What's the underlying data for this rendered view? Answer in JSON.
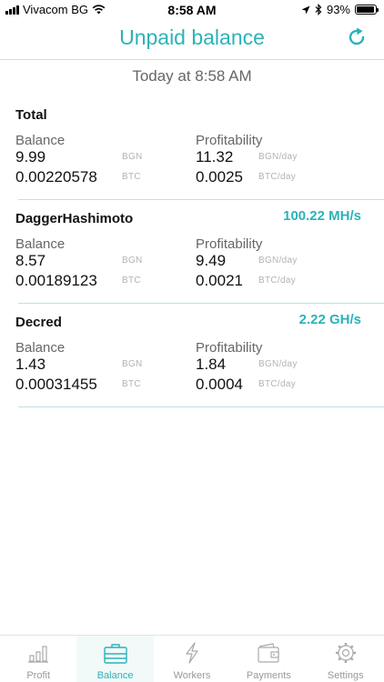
{
  "status_bar": {
    "carrier": "Vivacom BG",
    "time": "8:58 AM",
    "battery": "93%",
    "battery_level": 0.93,
    "icons": [
      "signal-icon",
      "wifi-icon",
      "location-icon",
      "bluetooth-icon",
      "battery-icon"
    ]
  },
  "header": {
    "title": "Unpaid balance",
    "refresh_icon": "refresh-icon"
  },
  "timestamp": "Today at 8:58 AM",
  "labels": {
    "balance": "Balance",
    "profitability": "Profitability",
    "bgn": "BGN",
    "btc": "BTC",
    "bgn_day": "BGN/day",
    "btc_day": "BTC/day"
  },
  "sections": [
    {
      "title": "Total",
      "rate": "",
      "balance_bgn": "9.99",
      "balance_btc": "0.00220578",
      "profit_bgn": "11.32",
      "profit_btc": "0.0025"
    },
    {
      "title": "DaggerHashimoto",
      "rate": "100.22 MH/s",
      "balance_bgn": "8.57",
      "balance_btc": "0.00189123",
      "profit_bgn": "9.49",
      "profit_btc": "0.0021"
    },
    {
      "title": "Decred",
      "rate": "2.22 GH/s",
      "balance_bgn": "1.43",
      "balance_btc": "0.00031455",
      "profit_bgn": "1.84",
      "profit_btc": "0.0004"
    }
  ],
  "accent_color": "#2bb3b8",
  "tabs": [
    {
      "label": "Profit",
      "icon": "bar-chart-icon",
      "active": false
    },
    {
      "label": "Balance",
      "icon": "briefcase-icon",
      "active": true
    },
    {
      "label": "Workers",
      "icon": "lightning-icon",
      "active": false
    },
    {
      "label": "Payments",
      "icon": "wallet-icon",
      "active": false
    },
    {
      "label": "Settings",
      "icon": "gear-icon",
      "active": false
    }
  ]
}
